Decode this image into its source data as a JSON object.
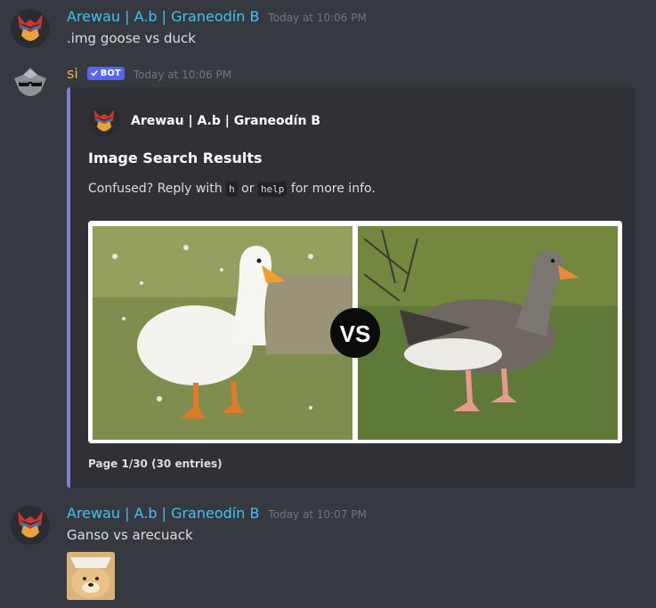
{
  "messages": [
    {
      "username": "Arewau | A.b | Graneodín B",
      "timestamp": "Today at 10:06 PM",
      "text": ".img goose vs duck"
    },
    {
      "username": "si",
      "bot_tag": "BOT",
      "timestamp": "Today at 10:06 PM",
      "embed": {
        "author": "Arewau | A.b | Graneodín B",
        "title": "Image Search Results",
        "desc_prefix": "Confused? Reply with",
        "desc_code1": "h",
        "desc_mid": "or",
        "desc_code2": "help",
        "desc_suffix": "for more info.",
        "vs_label": "VS",
        "footer": "Page 1/30 (30 entries)"
      }
    },
    {
      "username": "Arewau | A.b | Graneodín B",
      "timestamp": "Today at 10:07 PM",
      "text": "Ganso vs arecuack"
    }
  ],
  "colors": {
    "background": "#36393f",
    "embed_bg": "#2f3136",
    "embed_border": "#7b82d6",
    "username": "#3ec3f2",
    "bot_username": "#e6b347",
    "bot_tag": "#5865f2",
    "timestamp": "#72767d"
  },
  "icons": {
    "user_avatar": "red-masked-character-avatar-icon",
    "bot_avatar": "gray-sunglasses-character-avatar-icon",
    "verified": "checkmark-icon"
  }
}
